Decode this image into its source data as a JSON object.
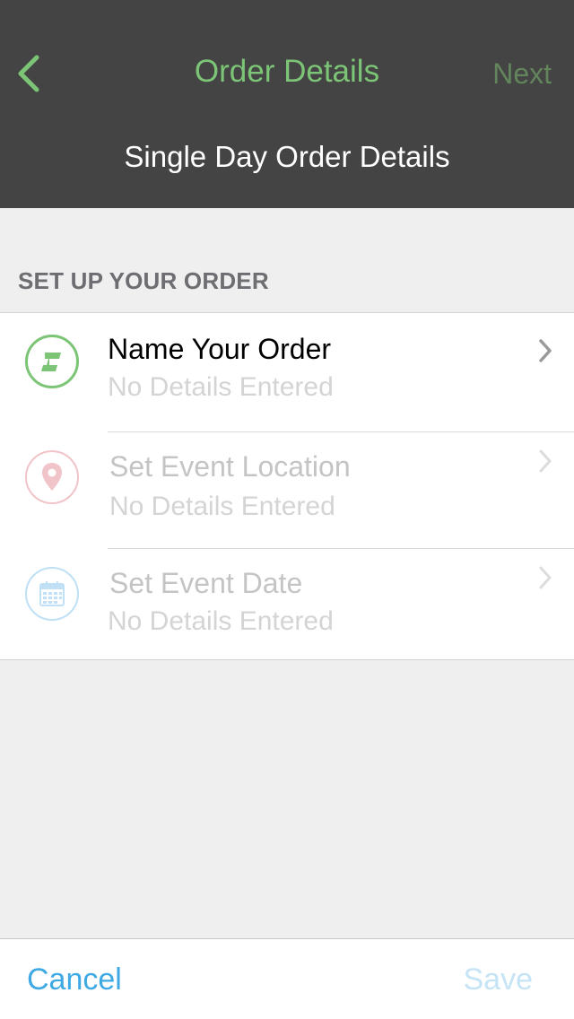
{
  "header": {
    "back_icon": "chevron-left-icon",
    "title": "Order Details",
    "next_label": "Next",
    "subtitle": "Single Day Order Details",
    "colors": {
      "background": "#444444",
      "title": "#7cc576",
      "next": "#62855c"
    }
  },
  "section": {
    "label": "SET UP YOUR ORDER"
  },
  "rows": [
    {
      "icon": "order-tag-icon",
      "title": "Name Your Order",
      "detail": "No Details Entered",
      "enabled": true,
      "color": "#7cc576"
    },
    {
      "icon": "location-pin-icon",
      "title": "Set Event Location",
      "detail": "No Details Entered",
      "enabled": false,
      "color": "#f0c4c8"
    },
    {
      "icon": "calendar-icon",
      "title": "Set Event Date",
      "detail": "No Details Entered",
      "enabled": false,
      "color": "#bfe0f5"
    }
  ],
  "footer": {
    "cancel_label": "Cancel",
    "save_label": "Save",
    "colors": {
      "cancel": "#3fa9e4",
      "save_disabled": "#c6e4f5"
    }
  }
}
